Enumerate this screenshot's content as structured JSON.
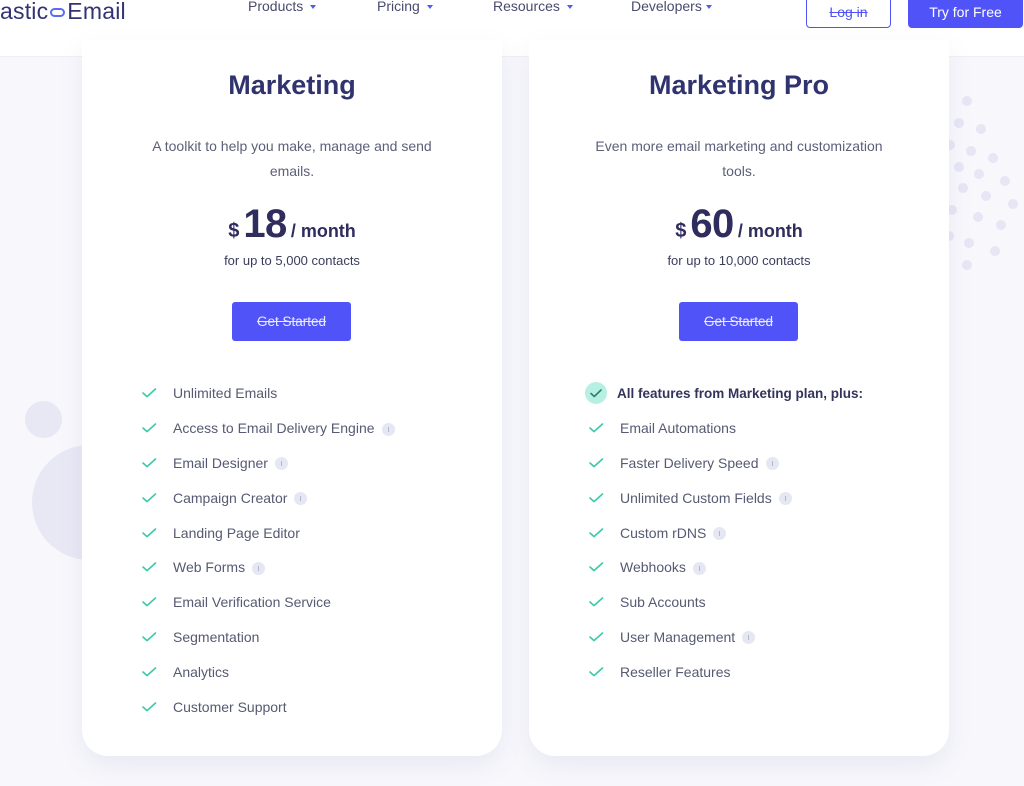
{
  "header": {
    "logo_text_left": "astic",
    "logo_text_right": "Email",
    "nav": [
      {
        "label": "Products"
      },
      {
        "label": "Pricing"
      },
      {
        "label": "Resources"
      },
      {
        "label": "Developers"
      }
    ],
    "login_label": "Log in",
    "try_label": "Try for Free"
  },
  "colors": {
    "accent": "#5054f8",
    "check": "#3cc9a8",
    "title": "#31336f"
  },
  "plans": [
    {
      "title": "Marketing",
      "description": "A toolkit to help you make, manage and send emails.",
      "currency": "$",
      "price": "18",
      "period": "/ month",
      "contacts": "for up to 5,000 contacts",
      "cta": "Get Started",
      "features": [
        {
          "label": "Unlimited Emails",
          "info": false
        },
        {
          "label": "Access to Email Delivery Engine",
          "info": true
        },
        {
          "label": "Email Designer",
          "info": true
        },
        {
          "label": "Campaign Creator",
          "info": true
        },
        {
          "label": "Landing Page Editor",
          "info": false
        },
        {
          "label": "Web Forms",
          "info": true
        },
        {
          "label": "Email Verification Service",
          "info": false
        },
        {
          "label": "Segmentation",
          "info": false
        },
        {
          "label": "Analytics",
          "info": false
        },
        {
          "label": "Customer Support",
          "info": false
        }
      ]
    },
    {
      "title": "Marketing Pro",
      "description": "Even more email marketing and customization tools.",
      "currency": "$",
      "price": "60",
      "period": "/ month",
      "contacts": "for up to 10,000 contacts",
      "cta": "Get Started",
      "features_heading": "All features from Marketing plan, plus:",
      "features": [
        {
          "label": "Email Automations",
          "info": false
        },
        {
          "label": "Faster Delivery Speed",
          "info": true
        },
        {
          "label": "Unlimited Custom Fields",
          "info": true
        },
        {
          "label": "Custom rDNS",
          "info": true
        },
        {
          "label": "Webhooks",
          "info": true
        },
        {
          "label": "Sub Accounts",
          "info": false
        },
        {
          "label": "User Management",
          "info": true
        },
        {
          "label": "Reseller Features",
          "info": false
        }
      ]
    }
  ]
}
